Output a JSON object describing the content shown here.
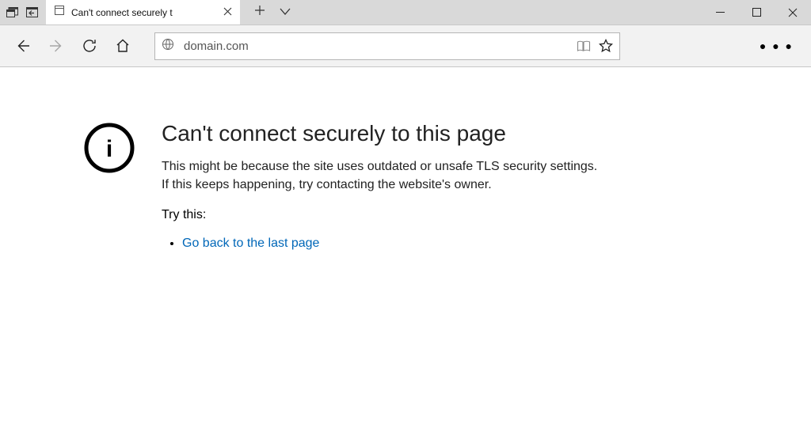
{
  "tab": {
    "title": "Can't connect securely t"
  },
  "address": {
    "url": "domain.com"
  },
  "error": {
    "heading": "Can't connect securely to this page",
    "body": "This might be because the site uses outdated or unsafe TLS security settings. If this keeps happening, try contacting the website's owner.",
    "try_label": "Try this:",
    "go_back": "Go back to the last page"
  }
}
